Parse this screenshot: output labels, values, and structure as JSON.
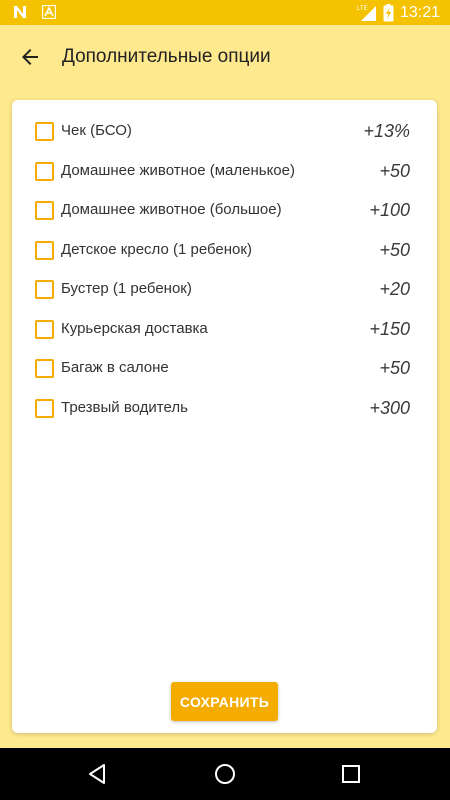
{
  "status_bar": {
    "time": "13:21",
    "icons": [
      "n-notification-icon",
      "a-notification-icon",
      "lte-signal-icon",
      "battery-charging-icon"
    ]
  },
  "app_bar": {
    "title": "Дополнительные опции",
    "back_icon": "arrow-back-icon"
  },
  "options": [
    {
      "label": "Чек (БСО)",
      "price": "+13%",
      "checked": false
    },
    {
      "label": "Домашнее животное (маленькое)",
      "price": "+50",
      "checked": false
    },
    {
      "label": "Домашнее животное (большое)",
      "price": "+100",
      "checked": false
    },
    {
      "label": "Детское кресло (1 ребенок)",
      "price": "+50",
      "checked": false
    },
    {
      "label": "Бустер (1 ребенок)",
      "price": "+20",
      "checked": false
    },
    {
      "label": "Курьерская доставка",
      "price": "+150",
      "checked": false
    },
    {
      "label": "Багаж в салоне",
      "price": "+50",
      "checked": false
    },
    {
      "label": "Трезвый водитель",
      "price": "+300",
      "checked": false
    }
  ],
  "save_button": {
    "label": "СОХРАНИТЬ"
  },
  "nav_bar": {
    "icons": [
      "back-triangle-icon",
      "home-circle-icon",
      "recents-square-icon"
    ]
  },
  "colors": {
    "status_bar": "#f4c200",
    "background": "#ffe98e",
    "accent": "#f4ac00",
    "nav_bar": "#000000"
  }
}
